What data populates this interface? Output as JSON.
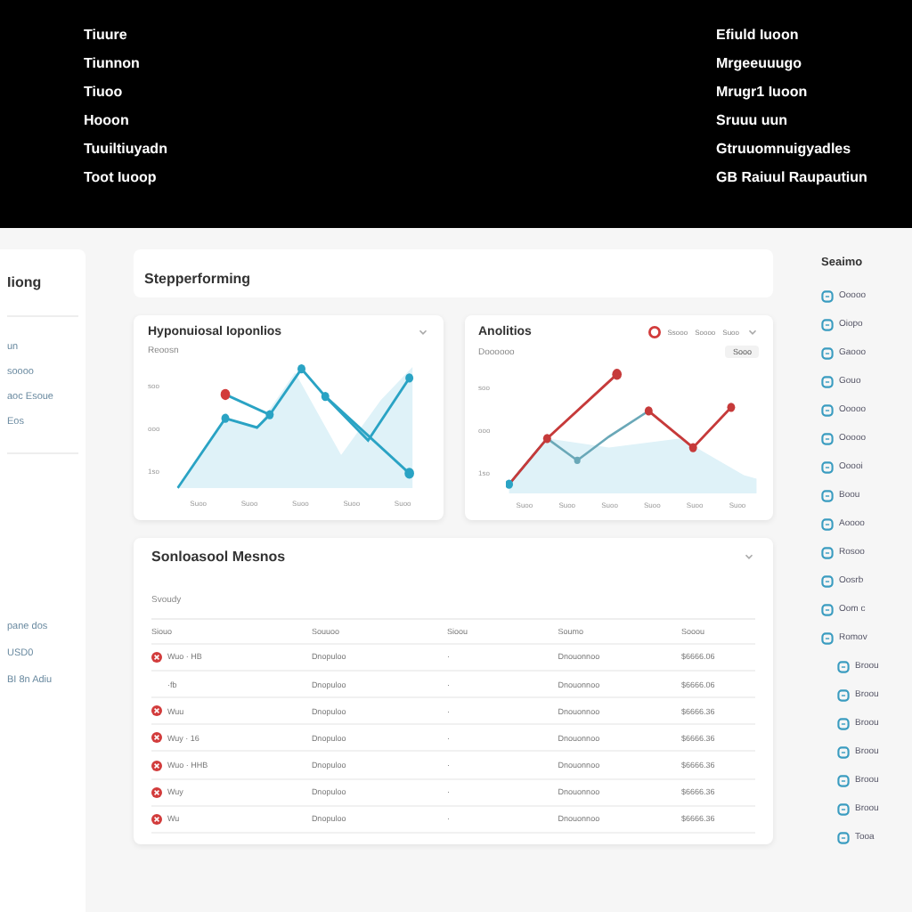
{
  "header": {
    "left_links": [
      "Tiuure",
      "Tiunnon",
      "Tiuoo",
      "Hooon",
      "Tuuiltiuyadn",
      "Toot Iuoop"
    ],
    "right_links": [
      "Efiuld Iuoon",
      "Mrgeeuuugo",
      "Mrugr1 Iuoon",
      "Sruuu uun",
      "Gtruuomnuigyadles",
      "GB Raiuul Raupautiun"
    ]
  },
  "left_sidebar": {
    "title": "Iiong",
    "items": [
      "un",
      "soooo",
      "aoc Esoue",
      "Eos"
    ],
    "footer_items": [
      "pane dos",
      "USD0",
      "BI 8n Adiu"
    ]
  },
  "section_title": "Stepperforming",
  "charts": [
    {
      "title": "Hyponuiosal Ioponlios",
      "subtitle": "Reoosn",
      "y_labels": [
        "soo",
        "ooo",
        "1so"
      ],
      "x_labels": [
        "Suoo",
        "Suoo",
        "Suoo",
        "Suoo",
        "Suoo"
      ],
      "kind": "single"
    },
    {
      "title": "Anolitios",
      "legend": [
        "Ssooo",
        "Soooo",
        "Suoo"
      ],
      "subtitle": "Doooooo",
      "badge": "Sooo",
      "y_labels": [
        "soo",
        "ooo",
        "1so"
      ],
      "x_labels": [
        "Suoo",
        "Suoo",
        "Suoo",
        "Suoo",
        "Suoo",
        "Suoo"
      ],
      "kind": "dual"
    }
  ],
  "table": {
    "title": "Sonloasool Mesnos",
    "subtitle": "Svoudy",
    "columns": [
      "Siouo",
      "Souuoo",
      "Sioou",
      "Soumo",
      "Sooou"
    ],
    "rows": [
      {
        "flagged": true,
        "cells": [
          "Wuo · HB",
          "Dnopuloo",
          "·",
          "Dnouonnoo",
          "$6666.06"
        ]
      },
      {
        "flagged": false,
        "cells": [
          "·fb",
          "Dnopuloo",
          "·",
          "Dnouonnoo",
          "$6666.06"
        ]
      },
      {
        "flagged": true,
        "cells": [
          "Wuu",
          "Dnopuloo",
          "·",
          "Dnouonnoo",
          "$6666.36"
        ]
      },
      {
        "flagged": true,
        "cells": [
          "Wuy · 16",
          "Dnopuloo",
          "·",
          "Dnouonnoo",
          "$6666.36"
        ]
      },
      {
        "flagged": true,
        "cells": [
          "Wuo · HHB",
          "Dnopuloo",
          "·",
          "Dnouonnoo",
          "$6666.36"
        ]
      },
      {
        "flagged": true,
        "cells": [
          "Wuy",
          "Dnopuloo",
          "·",
          "Dnouonnoo",
          "$6666.36"
        ]
      },
      {
        "flagged": true,
        "cells": [
          "Wu",
          "Dnopuloo",
          "·",
          "Dnouonnoo",
          "$6666.36"
        ]
      }
    ]
  },
  "right_sidebar": {
    "title": "Seaimo",
    "items": [
      {
        "label": "Ooooo"
      },
      {
        "label": "Oiopo"
      },
      {
        "label": "Gaooo"
      },
      {
        "label": "Gouo"
      },
      {
        "label": "Ooooo"
      },
      {
        "label": "Ooooo"
      },
      {
        "label": "Ooooi"
      },
      {
        "label": "Boou"
      },
      {
        "label": "Aoooo"
      },
      {
        "label": "Rosoo"
      },
      {
        "label": "Oosrb"
      },
      {
        "label": "Oom c"
      },
      {
        "label": "Romov",
        "children": [
          {
            "label": "Broou"
          },
          {
            "label": "Broou"
          },
          {
            "label": "Broou"
          },
          {
            "label": "Broou"
          },
          {
            "label": "Broou"
          },
          {
            "label": "Broou"
          },
          {
            "label": "Tooa"
          }
        ]
      }
    ]
  }
}
